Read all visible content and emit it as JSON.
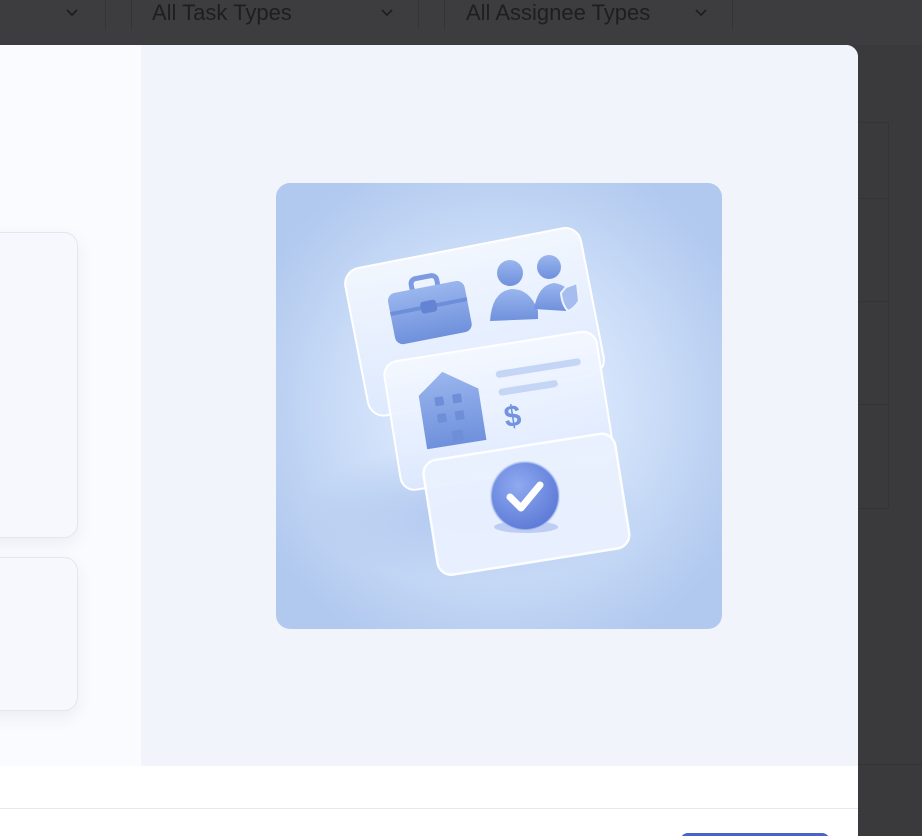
{
  "filters": {
    "task_type": "All Task Types",
    "assignee_type": "All Assignee Types"
  },
  "icons": {
    "chevron": "chevron-down-icon",
    "illustration": [
      "briefcase-icon",
      "users-shield-icon",
      "building-icon",
      "dollar-icon",
      "checkmark-icon"
    ]
  },
  "colors": {
    "accent": "#4a63c9",
    "illustration_bg": "#b4ccf2",
    "backdrop": "#3a3a3c"
  }
}
